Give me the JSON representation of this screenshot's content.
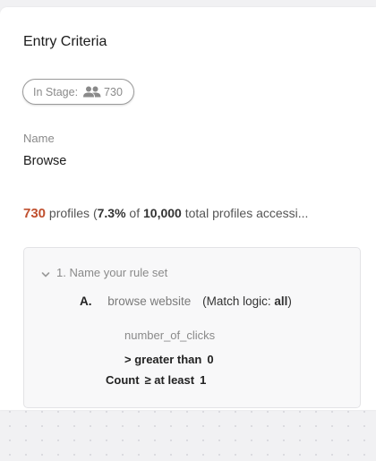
{
  "entry_criteria": {
    "title": "Entry Criteria",
    "in_stage_label": "In Stage:",
    "in_stage_count": "730",
    "name_label": "Name",
    "name_value": "Browse"
  },
  "profiles": {
    "count": "730",
    "text_prefix": "profiles (",
    "percent": "7.3%",
    "text_of": "of",
    "total": "10,000",
    "text_suffix": "total profiles accessi..."
  },
  "rule_set": {
    "header": "1.  Name your rule set",
    "rule": {
      "letter": "A.",
      "name": "browse website",
      "logic_prefix": "(Match logic:",
      "logic_value": "all",
      "logic_suffix": ")",
      "property": "number_of_clicks",
      "operator": "> greater than",
      "operand": "0",
      "count_label": "Count",
      "count_operator": "≥ at least",
      "count_value": "1"
    }
  },
  "colors": {
    "count_accent": "#c0502f",
    "muted_text": "#8a8a8a",
    "box_background": "#f8f8f9"
  },
  "icons": {
    "people": "people-icon",
    "chevron": "chevron-down-icon"
  }
}
